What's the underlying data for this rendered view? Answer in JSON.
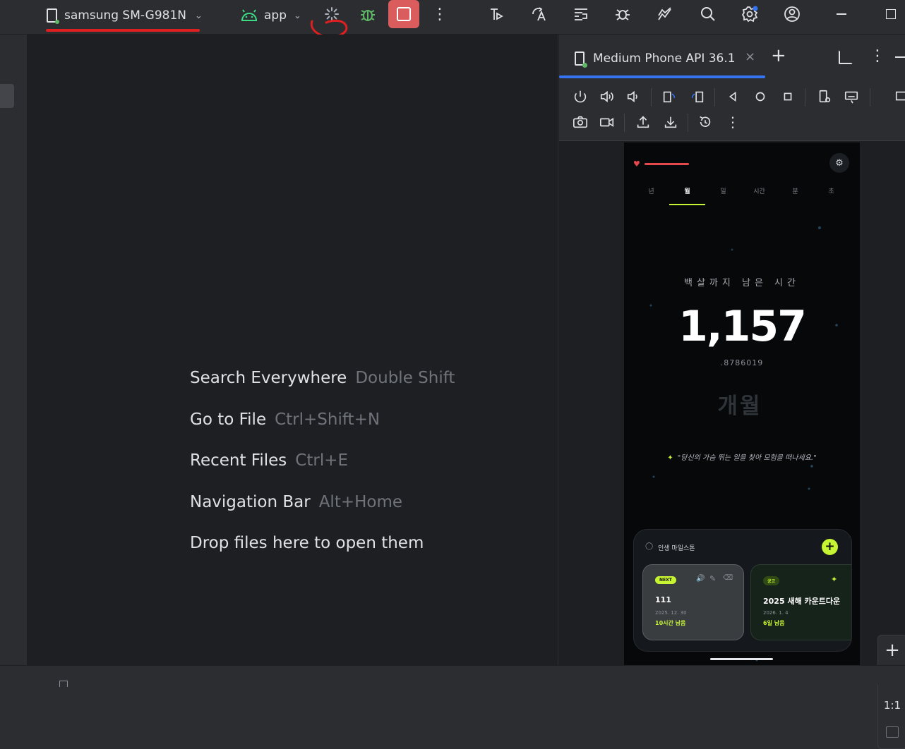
{
  "toolbar": {
    "device_label": "samsung SM-G981N",
    "run_config_label": "app",
    "colors": {
      "accent_red": "#e02020",
      "stop_bg": "#db5c5c",
      "run_green": "#5fb865",
      "android_green": "#3ddc84",
      "badge_blue": "#3574f0"
    }
  },
  "welcome_hints": [
    {
      "label": "Search Everywhere",
      "shortcut": "Double Shift"
    },
    {
      "label": "Go to File",
      "shortcut": "Ctrl+Shift+N"
    },
    {
      "label": "Recent Files",
      "shortcut": "Ctrl+E"
    },
    {
      "label": "Navigation Bar",
      "shortcut": "Alt+Home"
    },
    {
      "label": "Drop files here to open them",
      "shortcut": ""
    }
  ],
  "emulator": {
    "tab_label": "Medium Phone API 36.1",
    "zoom_reset_label": "1:1"
  },
  "phone": {
    "tabs": [
      "년",
      "월",
      "일",
      "시간",
      "분",
      "초"
    ],
    "active_tab": "월",
    "subtitle": "백살까지 남은 시간",
    "big_number": "1,157",
    "decimal": ".8786019",
    "unit": "개월",
    "quote": "\"당신의 가슴 뛰는 일을 찾아 모험을 떠나세요.\"",
    "milestones_title": "인생 마일스톤",
    "cards": [
      {
        "badge": "NEXT",
        "title": "111",
        "date": "2025. 12. 30",
        "remaining": "10시간 남음"
      },
      {
        "badge": "공고",
        "title": "2025 새해 카운트다운",
        "date": "2026. 1. 4",
        "remaining": "6일 남음"
      }
    ],
    "colors": {
      "accent_lime": "#c6f432",
      "heart_red": "#e5484d"
    }
  }
}
